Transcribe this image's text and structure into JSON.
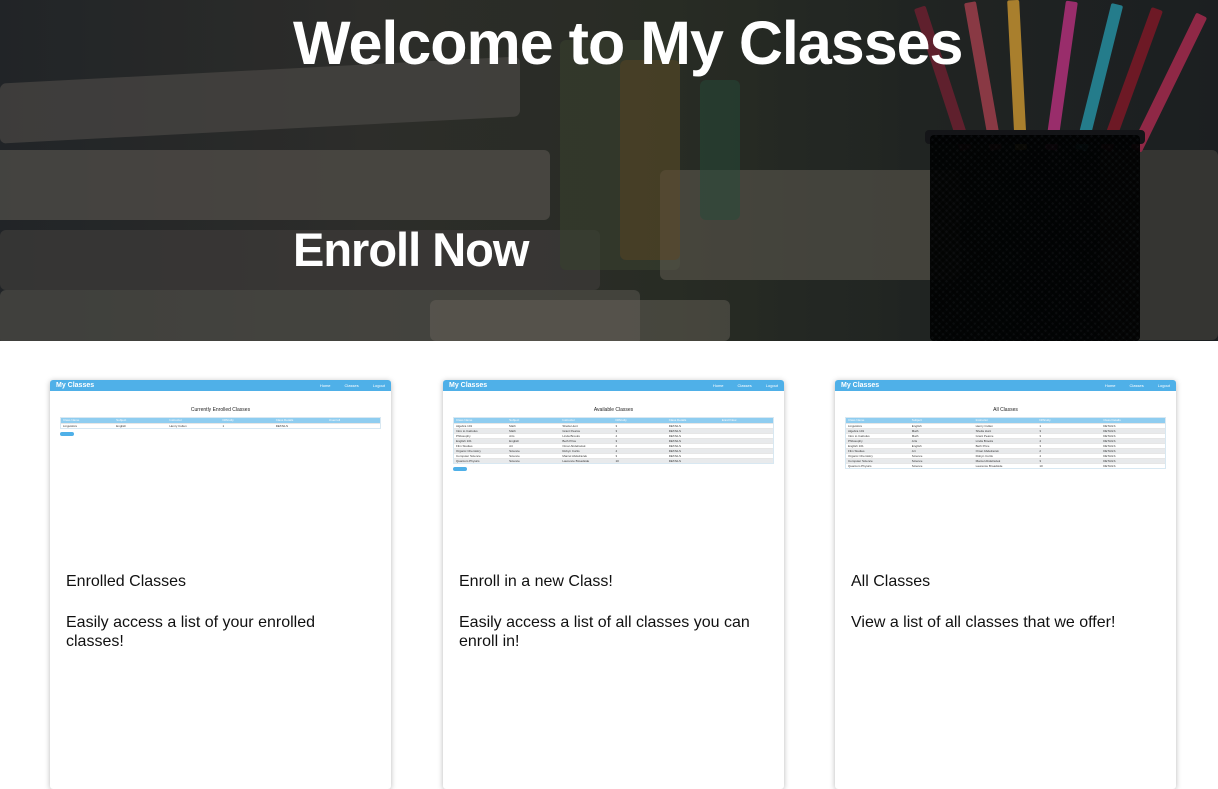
{
  "hero": {
    "title": "Welcome to My Classes",
    "subtitle": "Enroll Now"
  },
  "colors": {
    "accent": "#4fb0e8",
    "hero_overlay": "#2b2f33",
    "text": "#111111"
  },
  "cards": [
    {
      "title": "Enrolled Classes",
      "text": "Easily access a list of your enrolled classes!",
      "preview": {
        "brand": "My Classes",
        "nav": [
          "Home",
          "Classes",
          "Logout"
        ],
        "heading": "Currently Enrolled Classes",
        "columns": [
          "Class Name",
          "Subject",
          "Instructor",
          "Difficulty",
          "Class Details",
          "Unenroll"
        ],
        "rows": [
          [
            "Linguistics",
            "English",
            "Henry Cullen",
            "1",
            "DETAILS",
            ""
          ]
        ]
      }
    },
    {
      "title": "Enroll in a new Class!",
      "text": "Easily access a list of all classes you can enroll in!",
      "preview": {
        "brand": "My Classes",
        "nav": [
          "Home",
          "Classes",
          "Logout"
        ],
        "heading": "Available Classes",
        "columns": [
          "Class Name",
          "Subject",
          "Instructor",
          "Difficulty",
          "Class Details",
          "Enroll Now"
        ],
        "rows": [
          [
            "Algebra 101",
            "Math",
            "Sheila Hunt",
            "3",
            "DETAILS",
            ""
          ],
          [
            "Intro to Calculus",
            "Math",
            "Grant Pearce",
            "3",
            "DETAILS",
            ""
          ],
          [
            "Philosophy",
            "Arts",
            "Linda Brooks",
            "4",
            "DETAILS",
            ""
          ],
          [
            "English 101",
            "English",
            "Beth Price",
            "3",
            "DETAILS",
            ""
          ],
          [
            "Film Studies",
            "Art",
            "Omar Abdelrazek",
            "2",
            "DETAILS",
            ""
          ],
          [
            "Organic Chemistry",
            "Science",
            "Robyn Curtis",
            "4",
            "DETAILS",
            ""
          ],
          [
            "Computer Science",
            "Science",
            "Marcel Abdelrazek",
            "3",
            "DETAILS",
            ""
          ],
          [
            "Quantum Physics",
            "Science",
            "Laurence Broadside",
            "10",
            "DETAILS",
            ""
          ]
        ]
      }
    },
    {
      "title": "All Classes",
      "text": "View a list of all classes that we offer!",
      "preview": {
        "brand": "My Classes",
        "nav": [
          "Home",
          "Classes",
          "Logout"
        ],
        "heading": "All Classes",
        "columns": [
          "Class Name",
          "Subject",
          "Instructor",
          "Difficulty",
          "Class Details"
        ],
        "rows": [
          [
            "Linguistics",
            "English",
            "Henry Cullen",
            "1",
            "DETAILS"
          ],
          [
            "Algebra 101",
            "Math",
            "Sheila Hunt",
            "3",
            "DETAILS"
          ],
          [
            "Intro to Calculus",
            "Math",
            "Grant Pearce",
            "3",
            "DETAILS"
          ],
          [
            "Philosophy",
            "Arts",
            "Linda Brooks",
            "4",
            "DETAILS"
          ],
          [
            "English 101",
            "English",
            "Beth Price",
            "3",
            "DETAILS"
          ],
          [
            "Film Studies",
            "Art",
            "Omar Abdelrazek",
            "2",
            "DETAILS"
          ],
          [
            "Organic Chemistry",
            "Science",
            "Robyn Curtis",
            "4",
            "DETAILS"
          ],
          [
            "Computer Science",
            "Science",
            "Marcel Abdelrazek",
            "3",
            "DETAILS"
          ],
          [
            "Quantum Physics",
            "Science",
            "Laurence Broadside",
            "10",
            "DETAILS"
          ]
        ]
      }
    }
  ]
}
